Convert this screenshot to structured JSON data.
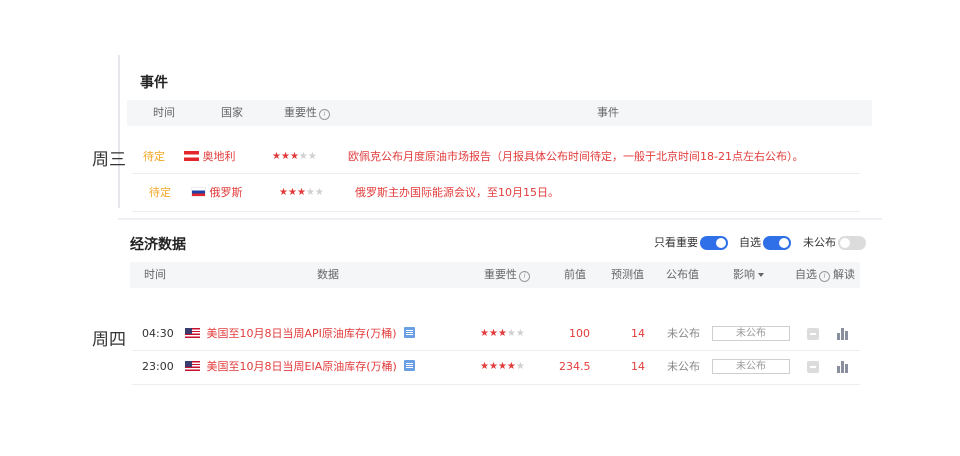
{
  "days": {
    "wed": "周三",
    "thu": "周四"
  },
  "events": {
    "title": "事件",
    "headers": {
      "time": "时间",
      "country": "国家",
      "importance": "重要性",
      "event": "事件"
    },
    "rows": [
      {
        "time": "待定",
        "country": "奥地利",
        "flag": "austria-flag",
        "stars": 3,
        "text": "欧佩克公布月度原油市场报告（月报具体公布时间待定，一般于北京时间18-21点左右公布）。"
      },
      {
        "time": "待定",
        "country": "俄罗斯",
        "flag": "russia-flag",
        "stars": 3,
        "text": "俄罗斯主办国际能源会议，至10月15日。"
      }
    ]
  },
  "econ": {
    "title": "经济数据",
    "toggles": [
      {
        "label": "只看重要",
        "on": true
      },
      {
        "label": "自选",
        "on": true
      },
      {
        "label": "未公布",
        "on": false
      }
    ],
    "headers": {
      "time": "时间",
      "data": "数据",
      "importance": "重要性",
      "prev": "前值",
      "forecast": "预测值",
      "actual": "公布值",
      "impact": "影响",
      "watch": "自选",
      "explain": "解读"
    },
    "rows": [
      {
        "time": "04:30",
        "flag": "us-flag",
        "name": "美国至10月8日当周API原油库存(万桶)",
        "stars": 3,
        "prev": "100",
        "forecast": "14",
        "actual": "未公布",
        "impact": "未公布"
      },
      {
        "time": "23:00",
        "flag": "us-flag",
        "name": "美国至10月8日当周EIA原油库存(万桶)",
        "stars": 4,
        "prev": "234.5",
        "forecast": "14",
        "actual": "未公布",
        "impact": "未公布"
      }
    ]
  },
  "colors": {
    "accent": "#2f6fe8",
    "red": "#e23b3b",
    "pending": "#f5a623"
  }
}
